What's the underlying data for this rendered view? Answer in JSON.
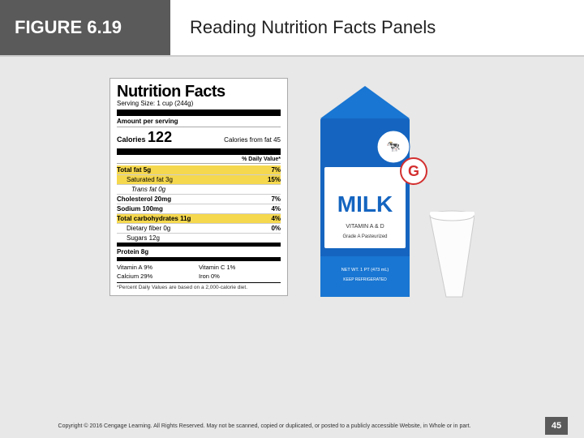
{
  "header": {
    "figure_label": "FIGURE 6.19",
    "title": "Reading Nutrition Facts Panels"
  },
  "nutrition_facts": {
    "title": "Nutrition Facts",
    "serving_size_label": "Serving Size:",
    "serving_size_value": "1 cup (244g)",
    "amount_per_serving": "Amount per serving",
    "calories_label": "Calories",
    "calories_value": "122",
    "calories_from_fat_label": "Calories from fat",
    "calories_from_fat_value": "45",
    "dv_header": "% Daily Value*",
    "rows": [
      {
        "label": "Total fat 5g",
        "pct": "7%",
        "highlight": true,
        "indent": 0
      },
      {
        "label": "Saturated fat 3g",
        "pct": "15%",
        "highlight": true,
        "indent": 1
      },
      {
        "label": "Trans fat 0g",
        "pct": "",
        "highlight": false,
        "indent": 2
      },
      {
        "label": "Cholesterol 20mg",
        "pct": "7%",
        "highlight": false,
        "indent": 0
      },
      {
        "label": "Sodium 100mg",
        "pct": "4%",
        "highlight": false,
        "indent": 0
      },
      {
        "label": "Total carbohydrates 11g",
        "pct": "4%",
        "highlight": true,
        "indent": 0
      },
      {
        "label": "Dietary fiber 0g",
        "pct": "0%",
        "highlight": false,
        "indent": 1
      },
      {
        "label": "Sugars 12g",
        "pct": "",
        "highlight": false,
        "indent": 1
      }
    ],
    "protein_row": "Protein 8g",
    "vitamins": [
      {
        "label": "Vitamin A  9%",
        "label2": "Vitamin C  1%"
      },
      {
        "label": "Calcium  29%",
        "label2": "Iron  0%"
      }
    ],
    "footnote": "*Percent Daily Values are based on a 2,000-calorie diet."
  },
  "footer": {
    "copyright": "Copyright © 2016 Cengage Learning. All Rights Reserved. May not be scanned, copied or duplicated, or posted to a publicly accessible Website, in Whole or in part.",
    "page_number": "45"
  }
}
